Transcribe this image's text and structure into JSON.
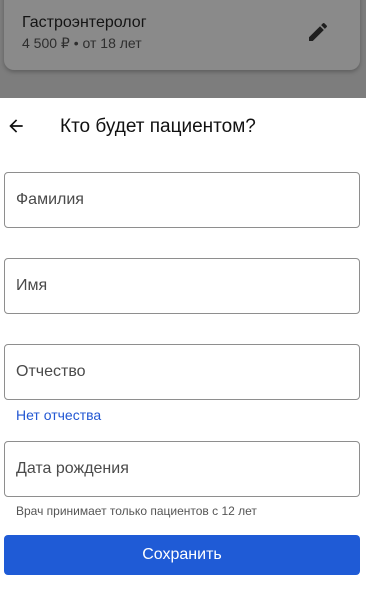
{
  "background_card": {
    "title": "Гастроэнтеролог",
    "subtitle": "4 500 ₽ • от 18 лет",
    "edit_icon": "pencil-icon"
  },
  "sheet": {
    "back_icon": "arrow-left-icon",
    "title": "Кто будет пациентом?",
    "fields": {
      "last_name_placeholder": "Фамилия",
      "first_name_placeholder": "Имя",
      "middle_name_placeholder": "Отчество",
      "birth_date_placeholder": "Дата рождения"
    },
    "no_middle_name_link": "Нет отчества",
    "age_hint": "Врач принимает только пациентов с 12 лет",
    "save_label": "Сохранить"
  },
  "colors": {
    "accent": "#1f5bd6",
    "link": "#2257d3",
    "backdrop": "#7d7d7d"
  }
}
